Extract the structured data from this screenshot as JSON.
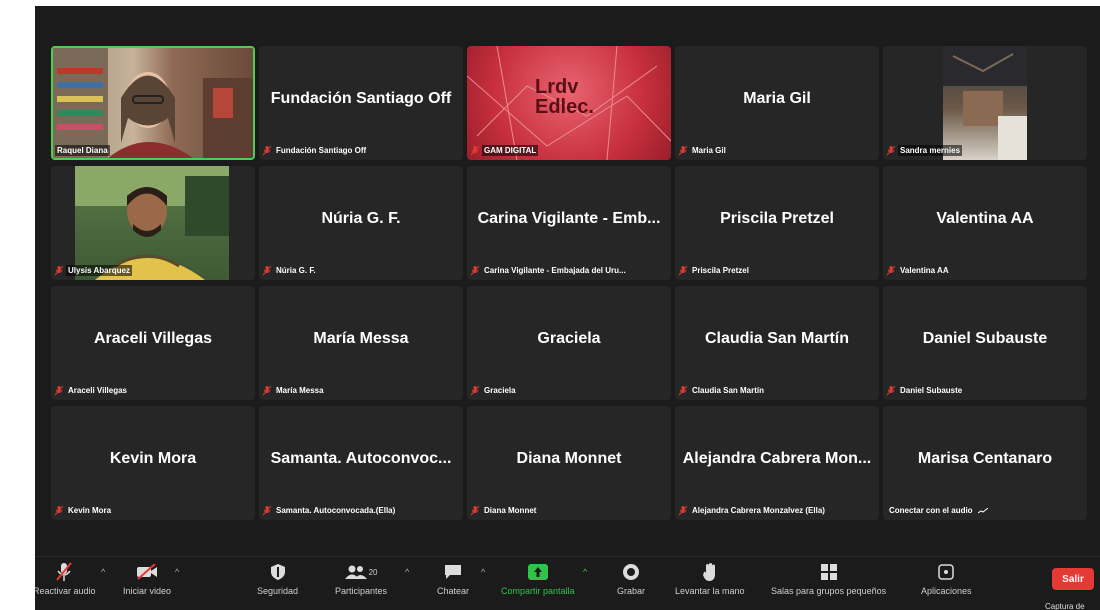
{
  "tiles": [
    {
      "big": "",
      "label": "Raquel Diana",
      "video": true
    },
    {
      "big": "Fundación Santiago Off",
      "label": "Fundación Santiago Off"
    },
    {
      "big": "",
      "label": "GAM DIGITAL",
      "video": true,
      "logo_line1": "Lrdv",
      "logo_line2": "Edlec."
    },
    {
      "big": "Maria Gil",
      "label": "Maria Gil"
    },
    {
      "big": "",
      "label": "Sandra mernies",
      "video": true
    },
    {
      "big": "",
      "label": "Ulysis Abarquez",
      "video": true
    },
    {
      "big": "Núria G. F.",
      "label": "Núria G. F."
    },
    {
      "big": "Carina Vigilante - Emb...",
      "label": "Carina Vigilante - Embajada del Uru..."
    },
    {
      "big": "Priscila Pretzel",
      "label": "Priscila Pretzel"
    },
    {
      "big": "Valentina AA",
      "label": "Valentina AA"
    },
    {
      "big": "Araceli Villegas",
      "label": "Araceli Villegas"
    },
    {
      "big": "María Messa",
      "label": "María Messa"
    },
    {
      "big": "Graciela",
      "label": "Graciela"
    },
    {
      "big": "Claudia San Martín",
      "label": "Claudia San Martín"
    },
    {
      "big": "Daniel Subauste",
      "label": "Daniel Subauste"
    },
    {
      "big": "Kevin Mora",
      "label": "Kevin Mora"
    },
    {
      "big": "Samanta. Autoconvoc...",
      "label": "Samanta. Autoconvocada.(Ella)"
    },
    {
      "big": "Diana Monnet",
      "label": "Diana Monnet"
    },
    {
      "big": "Alejandra Cabrera Mon...",
      "label": "Alejandra Cabrera Monzalvez (Ella)"
    },
    {
      "big": "Marisa Centanaro",
      "label": "Conectar con el audio"
    }
  ],
  "toolbar": {
    "unmute": "Reactivar audio",
    "start_video": "Iniciar video",
    "security": "Seguridad",
    "participants": "Participantes",
    "participants_count": "20",
    "chat": "Chatear",
    "share": "Compartir pantalla",
    "record": "Grabar",
    "raise_hand": "Levantar la mano",
    "breakout": "Salas para grupos pequeños",
    "apps": "Aplicaciones",
    "leave": "Salir"
  },
  "overlay": {
    "captura": "Captura de"
  },
  "colors": {
    "active_border": "#4ccf4c",
    "muted_red": "#e53935",
    "share_green": "#31c24a"
  }
}
